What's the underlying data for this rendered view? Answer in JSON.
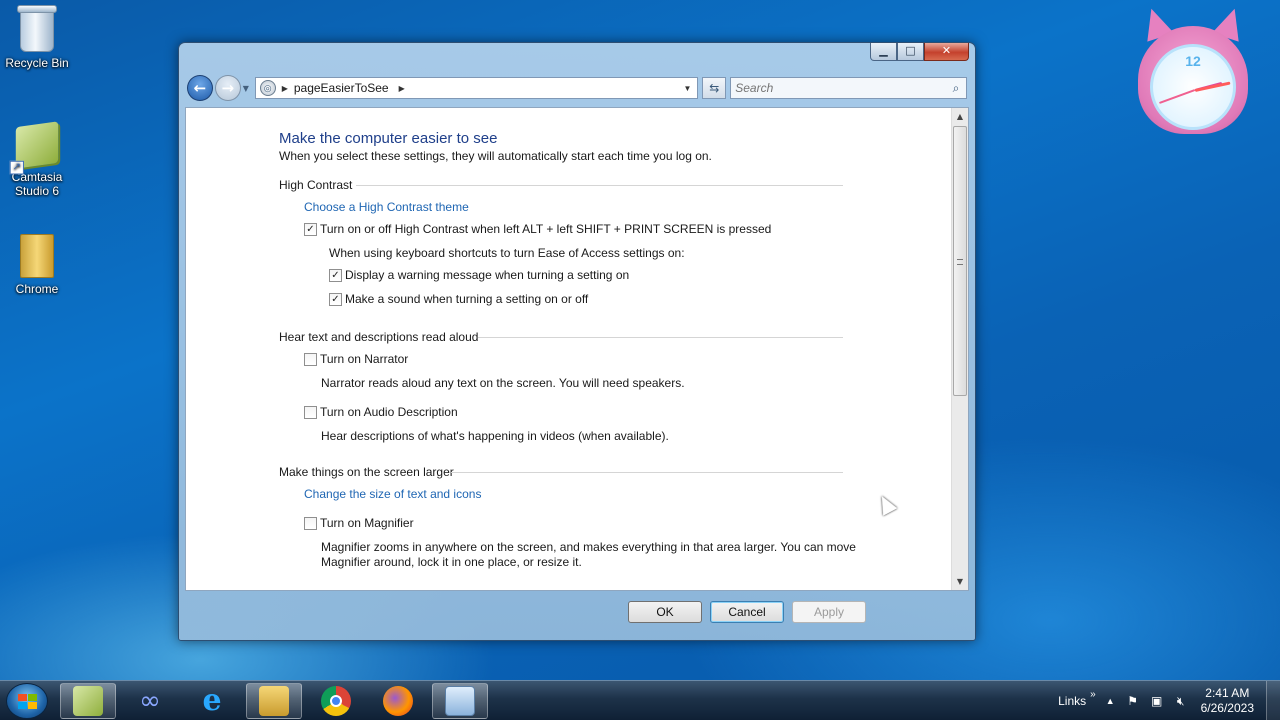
{
  "desktop": {
    "icons": [
      {
        "label": "Recycle Bin"
      },
      {
        "label": "Camtasia Studio 6"
      },
      {
        "label": "Chrome"
      }
    ]
  },
  "clock_gadget": {
    "twelve": "12"
  },
  "window": {
    "caption": {
      "minimize": "▁",
      "maximize": "□",
      "close": "✕"
    },
    "address": {
      "path": "pageEasierToSee"
    },
    "search": {
      "placeholder": "Search"
    },
    "content": {
      "heading": "Make the computer easier to see",
      "subheading": "When you select these settings, they will automatically start each time you log on.",
      "sections": [
        {
          "title": "High Contrast",
          "link": "Choose a High Contrast theme",
          "options": [
            {
              "label": "Turn on or off High Contrast when left ALT + left SHIFT + PRINT SCREEN is pressed",
              "checked": true
            }
          ],
          "sub_label": "When using keyboard shortcuts to turn Ease of Access settings on:",
          "sub_options": [
            {
              "label": "Display a warning message when turning a setting on",
              "checked": true
            },
            {
              "label": "Make a sound when turning a setting on or off",
              "checked": true
            }
          ]
        },
        {
          "title": "Hear text and descriptions read aloud",
          "options": [
            {
              "label": "Turn on Narrator",
              "checked": false,
              "description": "Narrator reads aloud any text on the screen. You will need speakers."
            },
            {
              "label": "Turn on Audio Description",
              "checked": false,
              "description": "Hear descriptions of what's happening in videos (when available)."
            }
          ]
        },
        {
          "title": "Make things on the screen larger",
          "link": "Change the size of text and icons",
          "options": [
            {
              "label": "Turn on Magnifier",
              "checked": false,
              "description": "Magnifier zooms in anywhere on the screen, and makes everything in that area larger. You can move Magnifier around, lock it in one place, or resize it."
            }
          ]
        }
      ]
    },
    "buttons": {
      "ok": "OK",
      "cancel": "Cancel",
      "apply": "Apply"
    }
  },
  "taskbar": {
    "items": [
      "start",
      "camtasia",
      "infinity",
      "internet-explorer",
      "file-explorer",
      "chrome",
      "firefox",
      "control-panel"
    ],
    "active_item": "control-panel",
    "tray": {
      "links": "Links",
      "links_chevron": "»",
      "time": "2:41 AM",
      "date": "6/26/2023"
    }
  },
  "colors": {
    "link": "#1f66b3",
    "heading": "#1f3f8a",
    "desktop": "#0b73c9",
    "taskbar": "#1d3249"
  }
}
